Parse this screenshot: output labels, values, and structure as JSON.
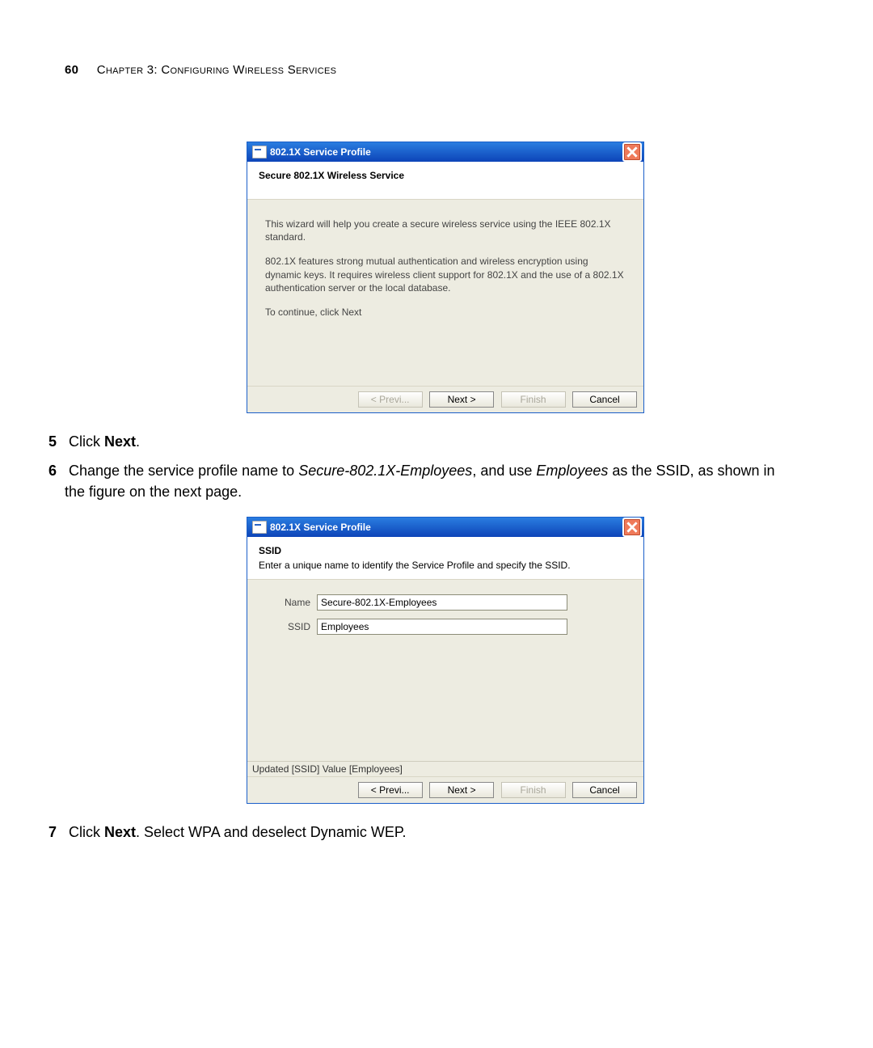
{
  "header": {
    "page_number": "60",
    "chapter": "Chapter 3: Configuring Wireless Services"
  },
  "dialog1": {
    "title": "802.1X Service Profile",
    "subheading": "Secure 802.1X Wireless Service",
    "para1": "This wizard will help you create a secure wireless service using the IEEE 802.1X standard.",
    "para2": "802.1X features strong mutual authentication and wireless encryption using dynamic keys. It requires wireless client support for 802.1X and the use of a 802.1X authentication server or the local database.",
    "para3": "To continue, click Next",
    "buttons": {
      "prev": "< Previ...",
      "next": "Next >",
      "finish": "Finish",
      "cancel": "Cancel"
    }
  },
  "step5": {
    "num": "5",
    "prefix": "Click ",
    "action": "Next",
    "suffix": "."
  },
  "step6": {
    "num": "6",
    "text_a": "Change the service profile name to ",
    "name": "Secure-802.1X-Employees",
    "text_b": ", and use ",
    "ssid": "Employees",
    "text_c": " as the SSID, as shown in the figure on the next page."
  },
  "dialog2": {
    "title": "802.1X Service Profile",
    "subheading": "SSID",
    "sub_desc": "Enter a unique name to identify the Service Profile and specify the SSID.",
    "name_label": "Name",
    "name_value": "Secure-802.1X-Employees",
    "ssid_label": "SSID",
    "ssid_value": "Employees",
    "status": "Updated [SSID] Value [Employees]",
    "buttons": {
      "prev": "< Previ...",
      "next": "Next >",
      "finish": "Finish",
      "cancel": "Cancel"
    }
  },
  "step7": {
    "num": "7",
    "prefix": "Click ",
    "action": "Next",
    "suffix": ". Select WPA and deselect Dynamic WEP."
  }
}
